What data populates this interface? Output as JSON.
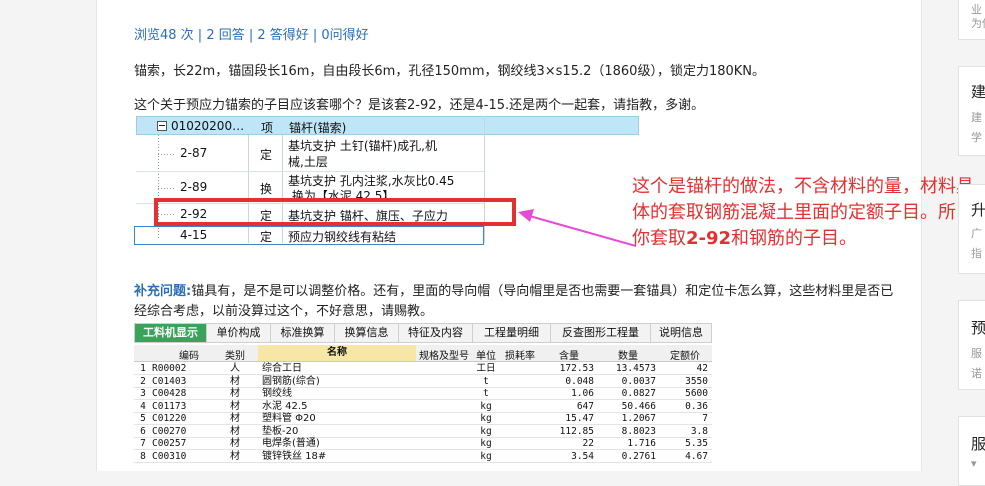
{
  "stats": "浏览48 次 | 2 回答 | 2 答得好 | 0问得好",
  "description": "锚索，长22m，锚固段长16m，自由段长6m，孔径150mm，钢绞线3×s15.2（1860级），锁定力180KN。",
  "question": "这个关于预应力锚索的子目应该套哪个？是该套2-92，还是4-15.还是两个一起套，请指教，多谢。",
  "quota_table": {
    "header": {
      "code": "01020200…",
      "type": "项",
      "name": "锚杆(锚索)"
    },
    "rows": [
      {
        "code": "2-87",
        "type": "定",
        "name_line1": "基坑支护 土钉(锚杆)成孔,机",
        "name_line2": "械,土层"
      },
      {
        "code": "2-89",
        "type": "换",
        "name_line1": "基坑支护 孔内注浆,水灰比0.45",
        "name_line2": ".换为【水泥 42.5】"
      },
      {
        "code": "2-92",
        "type": "定",
        "name_line1": "基坑支护 锚杆、旗压、子应力",
        "name_line2": ""
      },
      {
        "code": "4-15",
        "type": "定",
        "name_line1": "预应力钢绞线有粘结",
        "name_line2": ""
      }
    ]
  },
  "annotation": {
    "text_a": "这个是锚杆的做法，不含材料的量，材料具体的套取钢筋混凝土里面的定额子目。所以你套取",
    "bold": "2-92",
    "text_b": "和钢筋的子目。"
  },
  "supplement": {
    "label": "补充问题:",
    "text": "锚具有，是不是可以调整价格。还有，里面的导向帽（导向帽里是否也需要一套锚具）和定位卡怎么算，这些材料里是否已经综合考虑，以前没算过这个，不好意思，请赐教。"
  },
  "tabs": [
    "工料机显示",
    "单价构成",
    "标准换算",
    "换算信息",
    "特征及内容",
    "工程量明细",
    "反查图形工程量",
    "说明信息"
  ],
  "grid": {
    "headers": [
      "编码",
      "类别",
      "名称",
      "规格及型号",
      "单位",
      "损耗率",
      "含量",
      "数量",
      "定额价"
    ],
    "rows": [
      [
        "1",
        "R00002",
        "人",
        "综合工日",
        "",
        "工日",
        "",
        "172.53",
        "13.4573",
        "42"
      ],
      [
        "2",
        "C01403",
        "材",
        "圆钢筋(综合)",
        "",
        "t",
        "",
        "0.048",
        "0.0037",
        "3550"
      ],
      [
        "3",
        "C00428",
        "材",
        "钢绞线",
        "",
        "t",
        "",
        "1.06",
        "0.0827",
        "5600"
      ],
      [
        "4",
        "C01173",
        "材",
        "水泥 42.5",
        "",
        "kg",
        "",
        "647",
        "50.466",
        "0.36"
      ],
      [
        "5",
        "C01220",
        "材",
        "塑料管 Φ20",
        "",
        "kg",
        "",
        "15.47",
        "1.2067",
        "7"
      ],
      [
        "6",
        "C00270",
        "材",
        "垫板-20",
        "",
        "kg",
        "",
        "112.85",
        "8.8023",
        "3.8"
      ],
      [
        "7",
        "C00257",
        "材",
        "电焊条(普通)",
        "",
        "kg",
        "",
        "22",
        "1.716",
        "5.35"
      ],
      [
        "8",
        "C00310",
        "材",
        "镀锌铁丝 18#",
        "",
        "kg",
        "",
        "3.54",
        "0.2761",
        "4.67"
      ]
    ]
  },
  "sidebar": [
    {
      "title": "",
      "sub": "为你"
    },
    {
      "title": "建",
      "sub": "建",
      "sub2": "学"
    },
    {
      "title": "升",
      "sub": "广",
      "sub2": "指"
    },
    {
      "title": "预",
      "sub": "服",
      "sub2": "诺"
    },
    {
      "title": "服",
      "sub": "",
      "sub2": ""
    }
  ],
  "sidebar_top": "业"
}
